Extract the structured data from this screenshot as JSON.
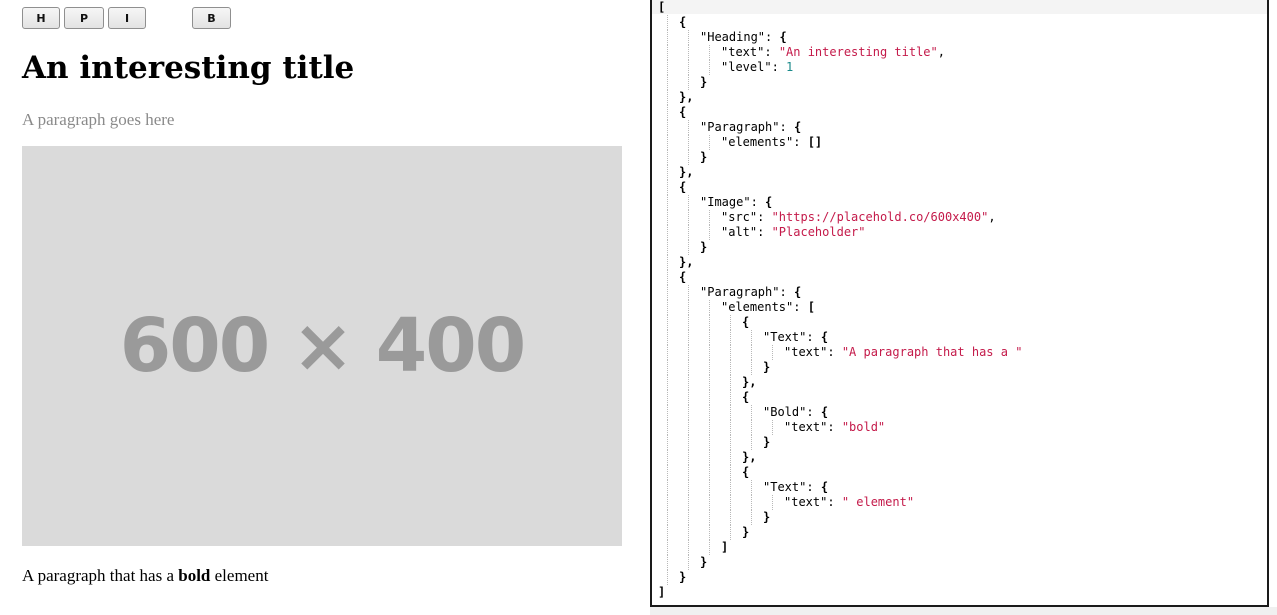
{
  "toolbar": {
    "buttons": [
      {
        "label": "H"
      },
      {
        "label": "P"
      },
      {
        "label": "I"
      },
      {
        "label": "B"
      }
    ]
  },
  "editor": {
    "title": "An interesting title",
    "placeholder_paragraph": "A paragraph goes here",
    "image": {
      "label": "600 × 400",
      "background": "#dadada",
      "text_color": "#9a9a9a"
    },
    "paragraph": {
      "before": "A paragraph that has a ",
      "bold": "bold",
      "after": " element"
    }
  },
  "json_view": {
    "colors": {
      "string": "#c41a4a",
      "number": "#1a8a8a"
    },
    "lines": [
      {
        "indent": 0,
        "parts": [
          {
            "t": "[",
            "c": "punc"
          }
        ]
      },
      {
        "indent": 1,
        "parts": [
          {
            "t": "{",
            "c": "punc"
          }
        ]
      },
      {
        "indent": 2,
        "parts": [
          {
            "t": "\"Heading\"",
            "c": "key"
          },
          {
            "t": ": ",
            "c": "punc-n"
          },
          {
            "t": "{",
            "c": "punc"
          }
        ]
      },
      {
        "indent": 3,
        "parts": [
          {
            "t": "\"text\"",
            "c": "key"
          },
          {
            "t": ": ",
            "c": "punc-n"
          },
          {
            "t": "\"An interesting title\"",
            "c": "str"
          },
          {
            "t": ",",
            "c": "punc-n"
          }
        ]
      },
      {
        "indent": 3,
        "parts": [
          {
            "t": "\"level\"",
            "c": "key"
          },
          {
            "t": ": ",
            "c": "punc-n"
          },
          {
            "t": "1",
            "c": "num"
          }
        ]
      },
      {
        "indent": 2,
        "parts": [
          {
            "t": "}",
            "c": "punc"
          }
        ]
      },
      {
        "indent": 1,
        "parts": [
          {
            "t": "},",
            "c": "punc"
          }
        ]
      },
      {
        "indent": 1,
        "parts": [
          {
            "t": "{",
            "c": "punc"
          }
        ]
      },
      {
        "indent": 2,
        "parts": [
          {
            "t": "\"Paragraph\"",
            "c": "key"
          },
          {
            "t": ": ",
            "c": "punc-n"
          },
          {
            "t": "{",
            "c": "punc"
          }
        ]
      },
      {
        "indent": 3,
        "parts": [
          {
            "t": "\"elements\"",
            "c": "key"
          },
          {
            "t": ": ",
            "c": "punc-n"
          },
          {
            "t": "[]",
            "c": "punc"
          }
        ]
      },
      {
        "indent": 2,
        "parts": [
          {
            "t": "}",
            "c": "punc"
          }
        ]
      },
      {
        "indent": 1,
        "parts": [
          {
            "t": "},",
            "c": "punc"
          }
        ]
      },
      {
        "indent": 1,
        "parts": [
          {
            "t": "{",
            "c": "punc"
          }
        ]
      },
      {
        "indent": 2,
        "parts": [
          {
            "t": "\"Image\"",
            "c": "key"
          },
          {
            "t": ": ",
            "c": "punc-n"
          },
          {
            "t": "{",
            "c": "punc"
          }
        ]
      },
      {
        "indent": 3,
        "parts": [
          {
            "t": "\"src\"",
            "c": "key"
          },
          {
            "t": ": ",
            "c": "punc-n"
          },
          {
            "t": "\"https://placehold.co/600x400\"",
            "c": "str"
          },
          {
            "t": ",",
            "c": "punc-n"
          }
        ]
      },
      {
        "indent": 3,
        "parts": [
          {
            "t": "\"alt\"",
            "c": "key"
          },
          {
            "t": ": ",
            "c": "punc-n"
          },
          {
            "t": "\"Placeholder\"",
            "c": "str"
          }
        ]
      },
      {
        "indent": 2,
        "parts": [
          {
            "t": "}",
            "c": "punc"
          }
        ]
      },
      {
        "indent": 1,
        "parts": [
          {
            "t": "},",
            "c": "punc"
          }
        ]
      },
      {
        "indent": 1,
        "parts": [
          {
            "t": "{",
            "c": "punc"
          }
        ]
      },
      {
        "indent": 2,
        "parts": [
          {
            "t": "\"Paragraph\"",
            "c": "key"
          },
          {
            "t": ": ",
            "c": "punc-n"
          },
          {
            "t": "{",
            "c": "punc"
          }
        ]
      },
      {
        "indent": 3,
        "parts": [
          {
            "t": "\"elements\"",
            "c": "key"
          },
          {
            "t": ": ",
            "c": "punc-n"
          },
          {
            "t": "[",
            "c": "punc"
          }
        ]
      },
      {
        "indent": 4,
        "parts": [
          {
            "t": "{",
            "c": "punc"
          }
        ]
      },
      {
        "indent": 5,
        "parts": [
          {
            "t": "\"Text\"",
            "c": "key"
          },
          {
            "t": ": ",
            "c": "punc-n"
          },
          {
            "t": "{",
            "c": "punc"
          }
        ]
      },
      {
        "indent": 6,
        "parts": [
          {
            "t": "\"text\"",
            "c": "key"
          },
          {
            "t": ": ",
            "c": "punc-n"
          },
          {
            "t": "\"A paragraph that has a \"",
            "c": "str"
          }
        ]
      },
      {
        "indent": 5,
        "parts": [
          {
            "t": "}",
            "c": "punc"
          }
        ]
      },
      {
        "indent": 4,
        "parts": [
          {
            "t": "},",
            "c": "punc"
          }
        ]
      },
      {
        "indent": 4,
        "parts": [
          {
            "t": "{",
            "c": "punc"
          }
        ]
      },
      {
        "indent": 5,
        "parts": [
          {
            "t": "\"Bold\"",
            "c": "key"
          },
          {
            "t": ": ",
            "c": "punc-n"
          },
          {
            "t": "{",
            "c": "punc"
          }
        ]
      },
      {
        "indent": 6,
        "parts": [
          {
            "t": "\"text\"",
            "c": "key"
          },
          {
            "t": ": ",
            "c": "punc-n"
          },
          {
            "t": "\"bold\"",
            "c": "str"
          }
        ]
      },
      {
        "indent": 5,
        "parts": [
          {
            "t": "}",
            "c": "punc"
          }
        ]
      },
      {
        "indent": 4,
        "parts": [
          {
            "t": "},",
            "c": "punc"
          }
        ]
      },
      {
        "indent": 4,
        "parts": [
          {
            "t": "{",
            "c": "punc"
          }
        ]
      },
      {
        "indent": 5,
        "parts": [
          {
            "t": "\"Text\"",
            "c": "key"
          },
          {
            "t": ": ",
            "c": "punc-n"
          },
          {
            "t": "{",
            "c": "punc"
          }
        ]
      },
      {
        "indent": 6,
        "parts": [
          {
            "t": "\"text\"",
            "c": "key"
          },
          {
            "t": ": ",
            "c": "punc-n"
          },
          {
            "t": "\" element\"",
            "c": "str"
          }
        ]
      },
      {
        "indent": 5,
        "parts": [
          {
            "t": "}",
            "c": "punc"
          }
        ]
      },
      {
        "indent": 4,
        "parts": [
          {
            "t": "}",
            "c": "punc"
          }
        ]
      },
      {
        "indent": 3,
        "parts": [
          {
            "t": "]",
            "c": "punc"
          }
        ]
      },
      {
        "indent": 2,
        "parts": [
          {
            "t": "}",
            "c": "punc"
          }
        ]
      },
      {
        "indent": 1,
        "parts": [
          {
            "t": "}",
            "c": "punc"
          }
        ]
      },
      {
        "indent": 0,
        "parts": [
          {
            "t": "]",
            "c": "punc"
          }
        ]
      }
    ]
  }
}
